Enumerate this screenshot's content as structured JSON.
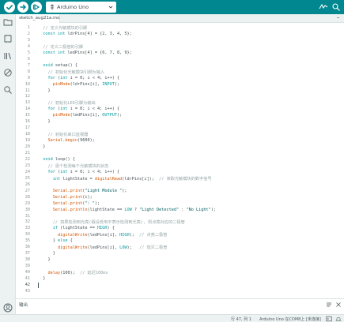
{
  "toolbar": {
    "board_name": "Arduino Uno",
    "accent": "#00878f"
  },
  "tabs": [
    {
      "label": "sketch_aug21a.ino"
    }
  ],
  "tab_menu": "···",
  "editor": {
    "lines": [
      {
        "n": "1",
        "text": "  // 定义光敏模块的引脚"
      },
      {
        "n": "2",
        "text": "  const int ldrPins[4] = {2, 3, 4, 5};"
      },
      {
        "n": "3",
        "text": ""
      },
      {
        "n": "4",
        "text": "  // 定义二极管的引脚"
      },
      {
        "n": "5",
        "text": "  const int ledPins[4] = {6, 7, 8, 9};"
      },
      {
        "n": "6",
        "text": ""
      },
      {
        "n": "7",
        "text": "  void setup() {"
      },
      {
        "n": "8",
        "text": "    // 初始化光敏模块引脚为输入"
      },
      {
        "n": "9",
        "text": "    for (int i = 0; i < 4; i++) {"
      },
      {
        "n": "10",
        "text": "      pinMode(ldrPins[i], INPUT);"
      },
      {
        "n": "11",
        "text": "    }"
      },
      {
        "n": "12",
        "text": ""
      },
      {
        "n": "13",
        "text": "    // 初始化LED引脚为输出"
      },
      {
        "n": "14",
        "text": "    for (int i = 0; i < 4; i++) {"
      },
      {
        "n": "15",
        "text": "      pinMode(ledPins[i], OUTPUT);"
      },
      {
        "n": "16",
        "text": "    }"
      },
      {
        "n": "17",
        "text": ""
      },
      {
        "n": "18",
        "text": "    // 初始化串口监视器"
      },
      {
        "n": "19",
        "text": "    Serial.begin(9600);"
      },
      {
        "n": "20",
        "text": "  }"
      },
      {
        "n": "21",
        "text": ""
      },
      {
        "n": "22",
        "text": "  void loop() {"
      },
      {
        "n": "23",
        "text": "    // 逐个检测每个光敏模块的状态"
      },
      {
        "n": "24",
        "text": "    for (int i = 0; i < 4; i++) {"
      },
      {
        "n": "25",
        "text": "      int lightState = digitalRead(ldrPins[i]);  // 读取光敏模块的数字信号"
      },
      {
        "n": "26",
        "text": ""
      },
      {
        "n": "27",
        "text": "      Serial.print(\"Light Module \");"
      },
      {
        "n": "28",
        "text": "      Serial.print(i);"
      },
      {
        "n": "29",
        "text": "      Serial.print(\": \");"
      },
      {
        "n": "30",
        "text": "      Serial.println(lightState == LOW ? \"Light Detected\" : \"No Light\");"
      },
      {
        "n": "31",
        "text": ""
      },
      {
        "n": "32",
        "text": "      // 如果检测到光亮(假设低电平表示检测到光亮), 则点亮对应的二极管"
      },
      {
        "n": "33",
        "text": "      if (lightState == HIGH) {"
      },
      {
        "n": "34",
        "text": "        digitalWrite(ledPins[i], HIGH);  // 点亮二极管"
      },
      {
        "n": "35",
        "text": "      } else {"
      },
      {
        "n": "36",
        "text": "        digitalWrite(ledPins[i], LOW);   // 熄灭二极管"
      },
      {
        "n": "37",
        "text": "      }"
      },
      {
        "n": "38",
        "text": "    }"
      },
      {
        "n": "39",
        "text": ""
      },
      {
        "n": "40",
        "text": "    delay(100);  // 延迟100ms"
      },
      {
        "n": "41",
        "text": "  }"
      },
      {
        "n": "42",
        "text": ""
      },
      {
        "n": "43",
        "text": ""
      }
    ]
  },
  "panel": {
    "title": "输出"
  },
  "statusbar": {
    "position": "行 47, 列 1",
    "board": "Arduino Uno 在COM8上 [未连接]"
  },
  "icons": {
    "verify": "check-icon",
    "upload": "arrow-right-icon",
    "debug": "debug-icon",
    "plotter": "plotter-icon",
    "monitor": "search-icon"
  }
}
